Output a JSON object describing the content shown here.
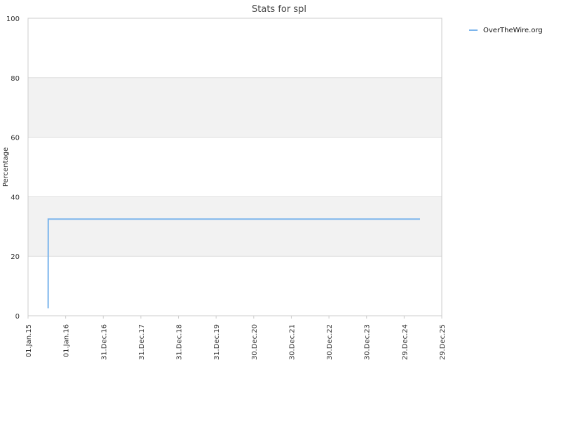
{
  "chart_data": {
    "type": "line",
    "title": "Stats for spl",
    "xlabel": "",
    "ylabel": "Percentage",
    "ylim": [
      0,
      100
    ],
    "yticks": [
      0,
      20,
      40,
      60,
      80,
      100
    ],
    "xlim": [
      "2015-01-01",
      "2025-12-29"
    ],
    "xticks": [
      {
        "label": "01.Jan.15",
        "date": "2015-01-01"
      },
      {
        "label": "01.Jan.16",
        "date": "2016-01-01"
      },
      {
        "label": "31.Dec.16",
        "date": "2016-12-31"
      },
      {
        "label": "31.Dec.17",
        "date": "2017-12-31"
      },
      {
        "label": "31.Dec.18",
        "date": "2018-12-31"
      },
      {
        "label": "31.Dec.19",
        "date": "2019-12-31"
      },
      {
        "label": "30.Dec.20",
        "date": "2020-12-30"
      },
      {
        "label": "30.Dec.21",
        "date": "2021-12-30"
      },
      {
        "label": "30.Dec.22",
        "date": "2022-12-30"
      },
      {
        "label": "30.Dec.23",
        "date": "2023-12-30"
      },
      {
        "label": "29.Dec.24",
        "date": "2024-12-29"
      },
      {
        "label": "29.Dec.25",
        "date": "2025-12-29"
      }
    ],
    "grid": true,
    "alternating_bands": true,
    "legend_position": "top-right",
    "series": [
      {
        "name": "OverTheWire.org",
        "color": "#7cb5ec",
        "points": [
          {
            "x": "2015-07-15",
            "y": 2.5
          },
          {
            "x": "2015-07-16",
            "y": 32.5
          },
          {
            "x": "2025-06-01",
            "y": 32.5
          }
        ]
      }
    ],
    "colors": {
      "band": "#f2f2f2",
      "grid": "#dddddd",
      "axis": "#cccccc"
    }
  }
}
